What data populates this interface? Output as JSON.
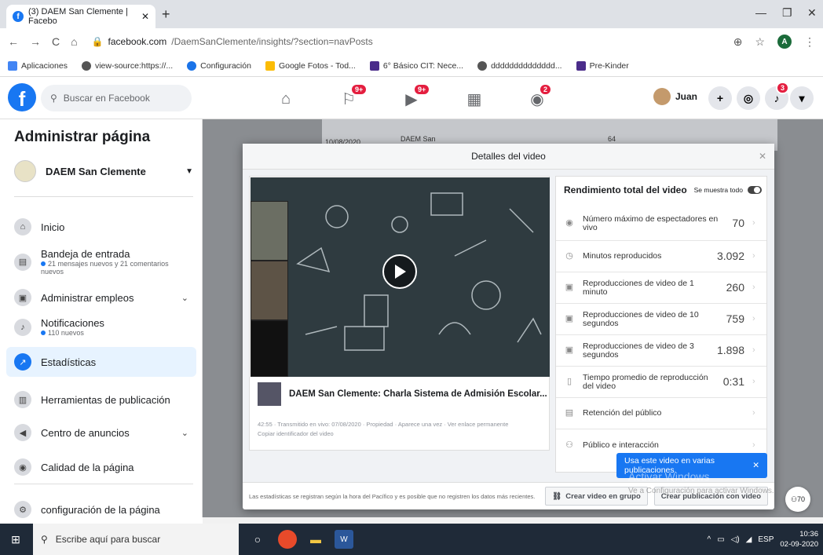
{
  "browser": {
    "tab_title": "(3) DAEM San Clemente | Facebo",
    "url_host": "facebook.com",
    "url_path": "/DaemSanClemente/insights/?section=navPosts",
    "bookmarks": [
      "Aplicaciones",
      "view-source:https://...",
      "Configuración",
      "Google Fotos - Tod...",
      "6° Básico CIT: Nece...",
      "dddddddddddddd...",
      "Pre-Kinder"
    ],
    "profile_initial": "A"
  },
  "fbbar": {
    "search_placeholder": "Buscar en Facebook",
    "badges": {
      "flag": "9+",
      "video": "9+",
      "groups": "2",
      "notifications": "3"
    },
    "user_name": "Juan"
  },
  "sidebar": {
    "title": "Administrar página",
    "page_name": "DAEM San Clemente",
    "items": [
      {
        "label": "Inicio",
        "sub": ""
      },
      {
        "label": "Bandeja de entrada",
        "sub": "21 mensajes nuevos y 21 comentarios nuevos"
      },
      {
        "label": "Administrar empleos",
        "sub": ""
      },
      {
        "label": "Notificaciones",
        "sub": "110 nuevos"
      },
      {
        "label": "Estadísticas",
        "sub": ""
      },
      {
        "label": "Herramientas de publicación",
        "sub": ""
      },
      {
        "label": "Centro de anuncios",
        "sub": ""
      },
      {
        "label": "Calidad de la página",
        "sub": ""
      },
      {
        "label": "configuración de la página",
        "sub": ""
      }
    ]
  },
  "background": {
    "date": "10/08/2020",
    "page": "DAEM San",
    "num": "64"
  },
  "modal": {
    "title": "Detalles del video",
    "video_title": "DAEM San Clemente: Charla Sistema de Admisión Escolar...",
    "meta_line1": "42:55 · Transmitido en vivo: 07/08/2020 · Propiedad · Aparece una vez · Ver enlace permanente",
    "meta_line2": "Copiar identificador del video",
    "stats_title": "Rendimiento total del video",
    "toggle_label": "Se muestra todo",
    "stats": [
      {
        "label": "Número máximo de espectadores en vivo",
        "value": "70",
        "icon": "eye-icon"
      },
      {
        "label": "Minutos reproducidos",
        "value": "3.092",
        "icon": "clock-icon"
      },
      {
        "label": "Reproducciones de video de 1 minuto",
        "value": "260",
        "icon": "camera-icon"
      },
      {
        "label": "Reproducciones de video de 10 segundos",
        "value": "759",
        "icon": "camera-icon"
      },
      {
        "label": "Reproducciones de video de 3 segundos",
        "value": "1.898",
        "icon": "camera-icon"
      },
      {
        "label": "Tiempo promedio de reproducción del video",
        "value": "0:31",
        "icon": "timer-icon"
      },
      {
        "label": "Retención del público",
        "value": "",
        "icon": "retention-icon"
      },
      {
        "label": "Público e interacción",
        "value": "",
        "icon": "people-icon"
      }
    ],
    "toast": "Usa este video en varias publicaciones.",
    "footer_note": "Las estadísticas se registran según la hora del Pacífico y es posible que no registren los datos más recientes.",
    "btn_group": "Crear video en grupo",
    "btn_post": "Crear publicación con video",
    "watermark": "Activar Windows",
    "watermark2": "Ve a Configuración para activar Windows."
  },
  "chat_count": "70",
  "taskbar": {
    "search_placeholder": "Escribe aquí para buscar",
    "lang": "ESP",
    "time": "10:36",
    "date": "02-09-2020"
  }
}
